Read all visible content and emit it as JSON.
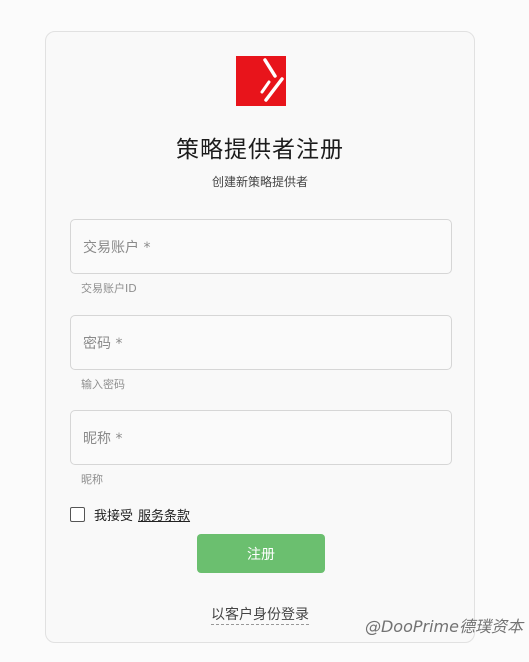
{
  "header": {
    "logo_icon": "brand-logo",
    "brand_color": "#e8141b",
    "title": "策略提供者注册",
    "subtitle": "创建新策略提供者"
  },
  "form": {
    "account": {
      "placeholder": "交易账户 *",
      "helper": "交易账户ID"
    },
    "password": {
      "placeholder": "密码 *",
      "helper": "输入密码"
    },
    "nickname": {
      "placeholder": "昵称 *",
      "helper": "昵称"
    },
    "terms": {
      "checked": false,
      "label": "我接受",
      "link": "服务条款"
    },
    "submit_label": "注册",
    "submit_color": "#6bbf6f"
  },
  "footer": {
    "customer_login": "以客户身份登录"
  },
  "watermark": "@DooPrime德璞资本"
}
